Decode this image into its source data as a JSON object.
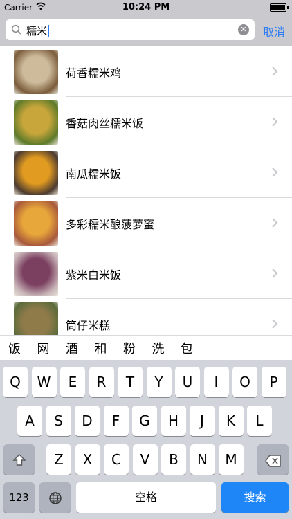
{
  "status_bar": {
    "carrier": "Carrier",
    "time": "10:24 PM"
  },
  "search": {
    "query": "糯米",
    "cancel_label": "取消"
  },
  "results": [
    {
      "title": "荷香糯米鸡",
      "colors": [
        "#cdbb9b",
        "#7a5b3a"
      ]
    },
    {
      "title": "香菇肉丝糯米饭",
      "colors": [
        "#c9a63b",
        "#5d7a2a"
      ]
    },
    {
      "title": "南瓜糯米饭",
      "colors": [
        "#e29b21",
        "#4b3a2f"
      ]
    },
    {
      "title": "多彩糯米酿菠萝蜜",
      "colors": [
        "#e8a73a",
        "#a8583b"
      ]
    },
    {
      "title": "紫米白米饭",
      "colors": [
        "#7b3f60",
        "#c9b6b9"
      ]
    },
    {
      "title": "筒仔米糕",
      "colors": [
        "#8f7a4a",
        "#5a6b3b"
      ]
    }
  ],
  "candidates": [
    "饭",
    "网",
    "酒",
    "和",
    "粉",
    "洗",
    "包"
  ],
  "keyboard": {
    "row1": [
      "Q",
      "W",
      "E",
      "R",
      "T",
      "Y",
      "U",
      "I",
      "O",
      "P"
    ],
    "row2": [
      "A",
      "S",
      "D",
      "F",
      "G",
      "H",
      "J",
      "K",
      "L"
    ],
    "row3": [
      "Z",
      "X",
      "C",
      "V",
      "B",
      "N",
      "M"
    ],
    "numbers_label": "123",
    "space_label": "空格",
    "search_label": "搜索"
  },
  "accent_color": "#2d7cf6"
}
